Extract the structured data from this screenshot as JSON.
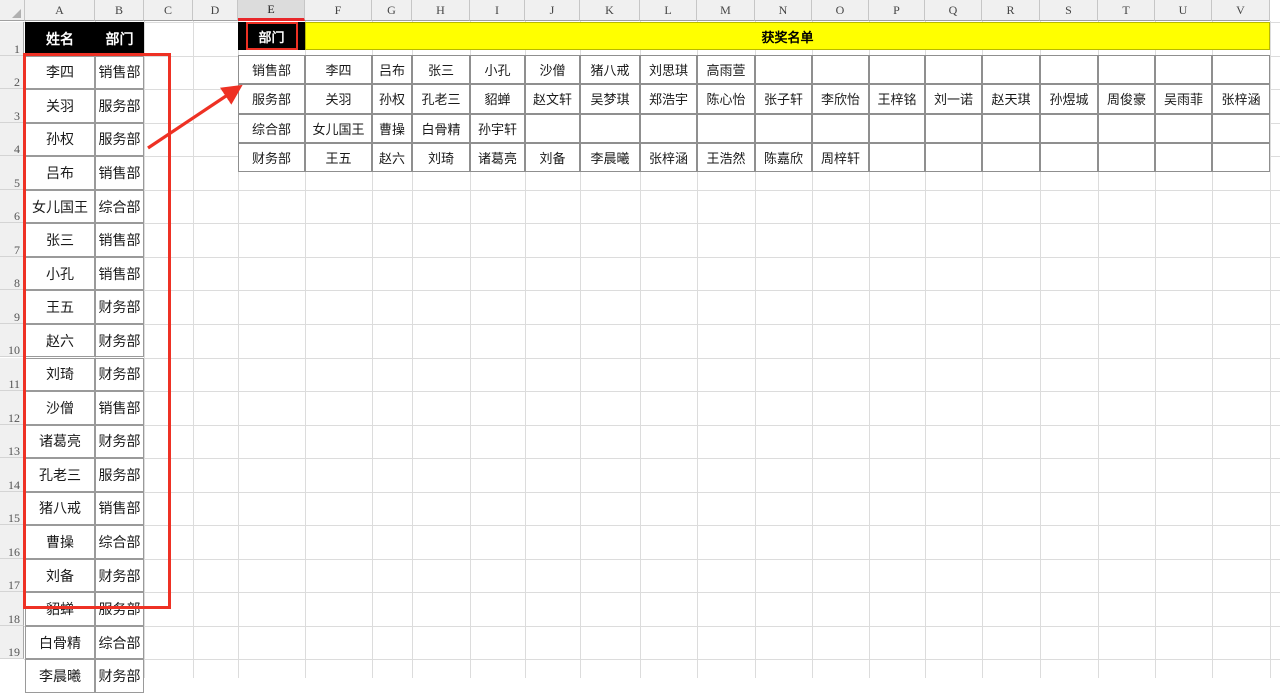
{
  "app": {
    "type": "spreadsheet",
    "colors": {
      "title_fill": "#ffff00",
      "header_fill": "#000000",
      "header_text": "#ffffff",
      "annotation": "#ee3124",
      "grid": "#d4d4d4"
    }
  },
  "column_headers": [
    "A",
    "B",
    "C",
    "D",
    "E",
    "F",
    "G",
    "H",
    "I",
    "J",
    "K",
    "L",
    "M",
    "N",
    "O",
    "P",
    "Q",
    "R",
    "S",
    "T",
    "U",
    "V"
  ],
  "selected_column": "E",
  "row_headers": [
    "1",
    "2",
    "3",
    "4",
    "5",
    "6",
    "7",
    "8",
    "9",
    "10",
    "11",
    "12",
    "13",
    "14",
    "15",
    "16",
    "17",
    "18",
    "19"
  ],
  "source_table": {
    "name": "source-name-department-table",
    "headers": [
      "姓名",
      "部门"
    ],
    "rows": [
      [
        "李四",
        "销售部"
      ],
      [
        "关羽",
        "服务部"
      ],
      [
        "孙权",
        "服务部"
      ],
      [
        "吕布",
        "销售部"
      ],
      [
        "女儿国王",
        "综合部"
      ],
      [
        "张三",
        "销售部"
      ],
      [
        "小孔",
        "销售部"
      ],
      [
        "王五",
        "财务部"
      ],
      [
        "赵六",
        "财务部"
      ],
      [
        "刘琦",
        "财务部"
      ],
      [
        "沙僧",
        "销售部"
      ],
      [
        "诸葛亮",
        "财务部"
      ],
      [
        "孔老三",
        "服务部"
      ],
      [
        "猪八戒",
        "销售部"
      ],
      [
        "曹操",
        "综合部"
      ],
      [
        "刘备",
        "财务部"
      ],
      [
        "貂蝉",
        "服务部"
      ],
      [
        "白骨精",
        "综合部"
      ],
      [
        "李晨曦",
        "财务部"
      ]
    ]
  },
  "result_table": {
    "name": "award-list-pivot-table",
    "title": "获奖名单",
    "corner_label": "部门",
    "rows": [
      {
        "department": "销售部",
        "names": [
          "李四",
          "吕布",
          "张三",
          "小孔",
          "沙僧",
          "猪八戒",
          "刘思琪",
          "高雨萱",
          "",
          "",
          "",
          "",
          "",
          "",
          "",
          "",
          ""
        ]
      },
      {
        "department": "服务部",
        "names": [
          "关羽",
          "孙权",
          "孔老三",
          "貂蝉",
          "赵文轩",
          "吴梦琪",
          "郑浩宇",
          "陈心怡",
          "张子轩",
          "李欣怡",
          "王梓铭",
          "刘一诺",
          "赵天琪",
          "孙煜城",
          "周俊豪",
          "吴雨菲",
          "张梓涵"
        ]
      },
      {
        "department": "综合部",
        "names": [
          "女儿国王",
          "曹操",
          "白骨精",
          "孙宇轩",
          "",
          "",
          "",
          "",
          "",
          "",
          "",
          "",
          "",
          "",
          "",
          "",
          ""
        ]
      },
      {
        "department": "财务部",
        "names": [
          "王五",
          "赵六",
          "刘琦",
          "诸葛亮",
          "刘备",
          "李晨曦",
          "张梓涵",
          "王浩然",
          "陈嘉欣",
          "周梓轩",
          "",
          "",
          "",
          "",
          "",
          "",
          ""
        ]
      }
    ]
  },
  "annotations": {
    "source_highlight_box": "red-rectangle-around-source-data",
    "dept_cell_highlight_box": "red-rectangle-around-department-cell",
    "arrow": "red-arrow-from-source-to-result"
  }
}
